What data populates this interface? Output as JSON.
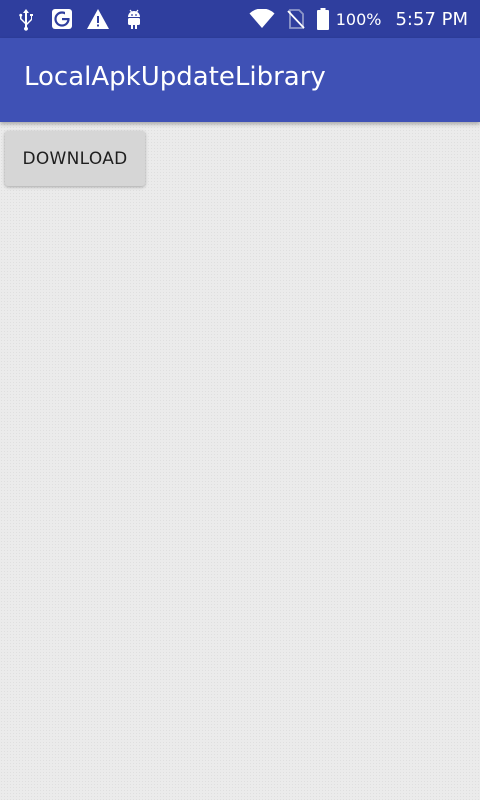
{
  "status_bar": {
    "background": "#2f3e9e",
    "left_icons": [
      "usb-icon",
      "g-notification-icon",
      "warning-icon",
      "android-debug-icon"
    ],
    "right_icons": [
      "wifi-icon",
      "no-sim-icon",
      "battery-icon"
    ],
    "battery_percent": "100%",
    "time": "5:57 PM"
  },
  "app_bar": {
    "title": "LocalApkUpdateLibrary",
    "background": "#3f51b5"
  },
  "main": {
    "download_button_label": "DOWNLOAD",
    "background": "#ebebeb"
  }
}
